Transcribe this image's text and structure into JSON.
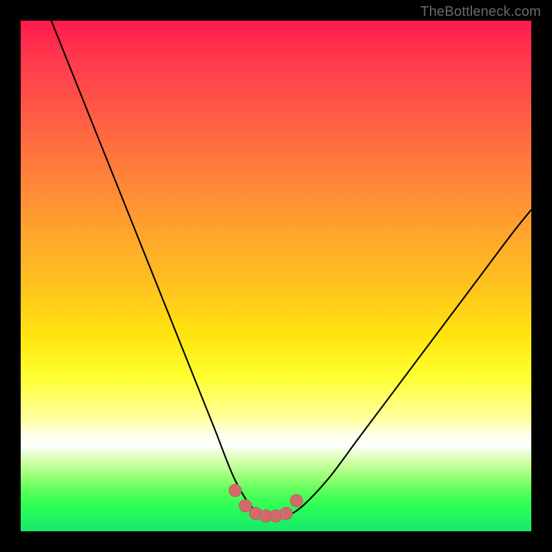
{
  "watermark": {
    "text": "TheBottleneck.com"
  },
  "colors": {
    "frame": "#000000",
    "curve": "#000000",
    "marker_fill": "#d16a6a",
    "marker_stroke": "#c25e5e"
  },
  "chart_data": {
    "type": "line",
    "title": "",
    "xlabel": "",
    "ylabel": "",
    "xlim": [
      0,
      100
    ],
    "ylim": [
      0,
      100
    ],
    "grid": false,
    "legend": false,
    "note": "Axes are unlabeled in the source image; x/y values are estimated normalized percentages of the plot area (0–100). The black curve is a V-shaped profile with a flat minimum near x≈40–50 at y≈3. Salmon markers sit on the flat valley.",
    "series": [
      {
        "name": "curve",
        "x": [
          6,
          10,
          14,
          18,
          22,
          26,
          30,
          34,
          38,
          42,
          46,
          50,
          54,
          60,
          66,
          72,
          78,
          84,
          90,
          96,
          100
        ],
        "values": [
          100,
          90,
          80,
          70,
          60,
          50,
          40,
          30,
          20,
          10,
          4,
          3,
          4,
          10,
          18,
          26,
          34,
          42,
          50,
          58,
          63
        ]
      }
    ],
    "markers": {
      "name": "valley-points",
      "x": [
        42,
        44,
        46,
        48,
        50,
        52,
        54
      ],
      "values": [
        8,
        5,
        3.5,
        3,
        3,
        3.5,
        6
      ]
    }
  }
}
